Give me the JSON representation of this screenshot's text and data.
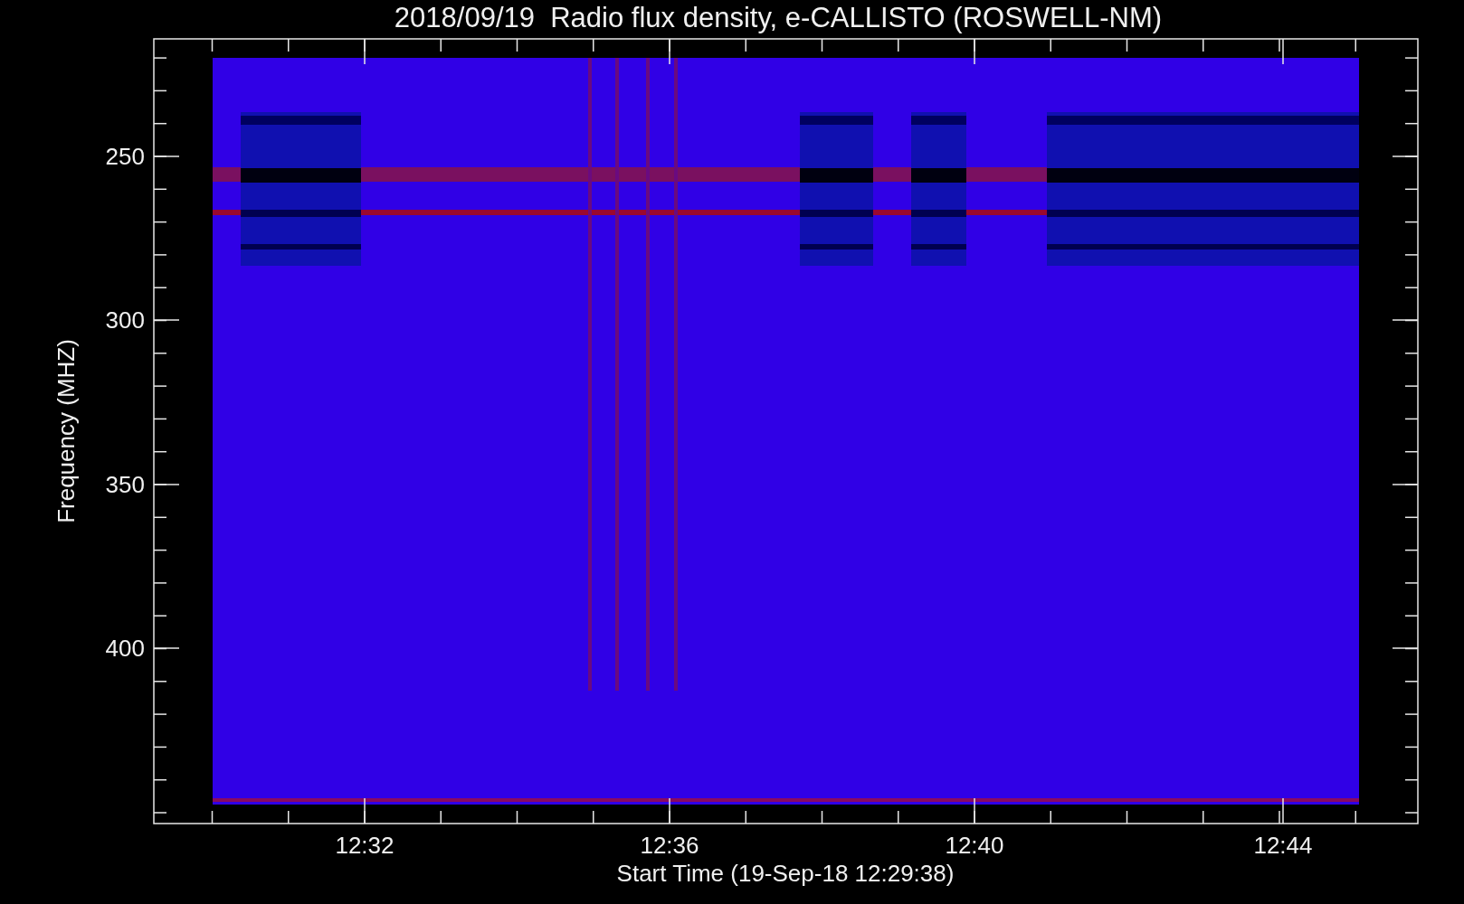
{
  "title": "2018/09/19  Radio flux density, e-CALLISTO (ROSWELL-NM)",
  "y_axis": {
    "label": "Frequency (MHZ)",
    "ticks": [
      "250",
      "300",
      "350",
      "400"
    ]
  },
  "x_axis": {
    "label": "Start Time (19-Sep-18 12:29:38)",
    "ticks": [
      "12:32",
      "12:36",
      "12:40",
      "12:44"
    ]
  }
}
